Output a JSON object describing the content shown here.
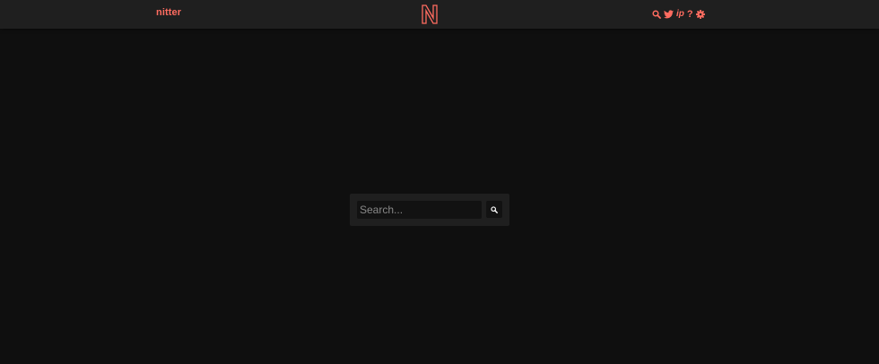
{
  "navbar": {
    "brand": "nitter",
    "logo_icon": "nitter-n-logo",
    "icons": [
      "search-icon",
      "twitter-bird-icon",
      "rss-icon",
      "help-icon",
      "gear-icon"
    ],
    "rss_glyph": "ip",
    "help_glyph": "?"
  },
  "search": {
    "placeholder": "Search...",
    "value": "",
    "button_icon": "search-icon"
  },
  "colors": {
    "accent": "#ff6c60",
    "background": "#0f0f0f",
    "panel": "#1f1f1f",
    "input": "#121212"
  }
}
